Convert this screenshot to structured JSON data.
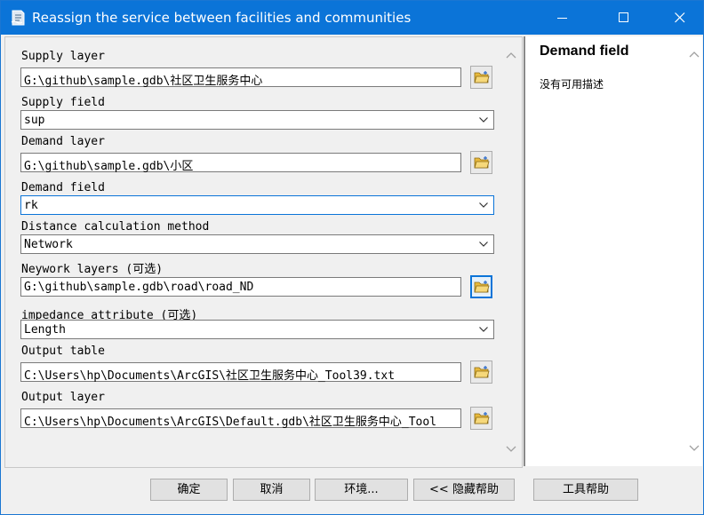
{
  "window": {
    "title": "Reassign the service between facilities and communities",
    "controls": {
      "minimize_icon": "minimize-icon",
      "maximize_icon": "maximize-icon",
      "close_icon": "close-icon"
    }
  },
  "params": [
    {
      "label": "Supply layer",
      "value": "G:\\github\\sample.gdb\\社区卫生服务中心",
      "kind": "browse"
    },
    {
      "label": "Supply field",
      "value": "sup",
      "kind": "dropdown"
    },
    {
      "label": "Demand layer",
      "value": "G:\\github\\sample.gdb\\小区",
      "kind": "browse"
    },
    {
      "label": "Demand field",
      "value": "rk",
      "kind": "dropdown",
      "focused": true
    },
    {
      "label": "Distance calculation method",
      "value": "Network",
      "kind": "dropdown"
    },
    {
      "label": "Neywork layers (可选)",
      "value": "G:\\github\\sample.gdb\\road\\road_ND",
      "kind": "browse",
      "button_focused": true
    },
    {
      "label": "impedance_attribute (可选)",
      "value": "Length",
      "kind": "dropdown"
    },
    {
      "label": "Output table",
      "value": "C:\\Users\\hp\\Documents\\ArcGIS\\社区卫生服务中心_Tool39.txt",
      "kind": "browse"
    },
    {
      "label": "Output layer",
      "value": "C:\\Users\\hp\\Documents\\ArcGIS\\Default.gdb\\社区卫生服务中心_Tool",
      "kind": "browse"
    }
  ],
  "help": {
    "title": "Demand field",
    "description": "没有可用描述"
  },
  "buttons": {
    "ok": "确定",
    "cancel": "取消",
    "environments": "环境...",
    "hide_help": "<< 隐藏帮助",
    "tool_help": "工具帮助"
  },
  "colors": {
    "titlebar": "#0b74d8",
    "focus": "#0b74d8",
    "folder": "#e8b93b"
  }
}
